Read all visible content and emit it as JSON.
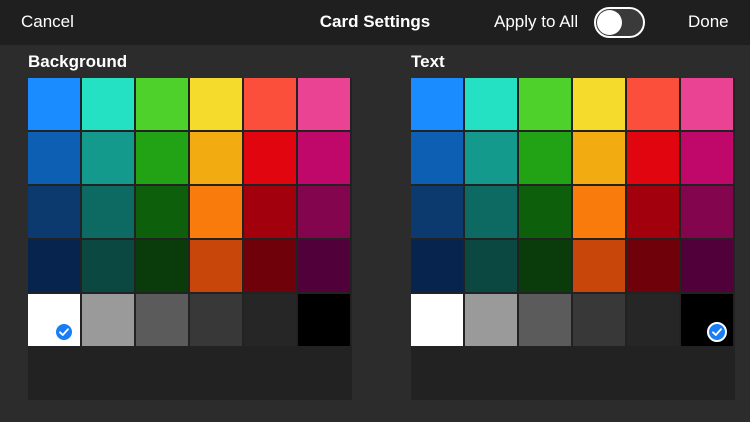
{
  "header": {
    "cancel_label": "Cancel",
    "title": "Card Settings",
    "apply_label": "Apply to All",
    "apply_on": false,
    "done_label": "Done"
  },
  "colors": [
    [
      "#1a8cff",
      "#25e1c4",
      "#4fd12b",
      "#f5dc2c",
      "#fb4f3c",
      "#ea4393"
    ],
    [
      "#0d5fb3",
      "#139a8c",
      "#22a316",
      "#f3ab12",
      "#e1050f",
      "#c0086a"
    ],
    [
      "#0d3a6e",
      "#0d6a62",
      "#0e5f0c",
      "#f97b0c",
      "#a3000d",
      "#83054d"
    ],
    [
      "#06244d",
      "#0a4841",
      "#0a3c0b",
      "#c9460b",
      "#6e0109",
      "#52003a"
    ],
    [
      "#ffffff",
      "#9a9a9a",
      "#5b5b5b",
      "#383838",
      "#262626",
      "#000000"
    ]
  ],
  "background": {
    "label": "Background",
    "selected": [
      4,
      0
    ]
  },
  "text": {
    "label": "Text",
    "selected": [
      4,
      5
    ]
  }
}
